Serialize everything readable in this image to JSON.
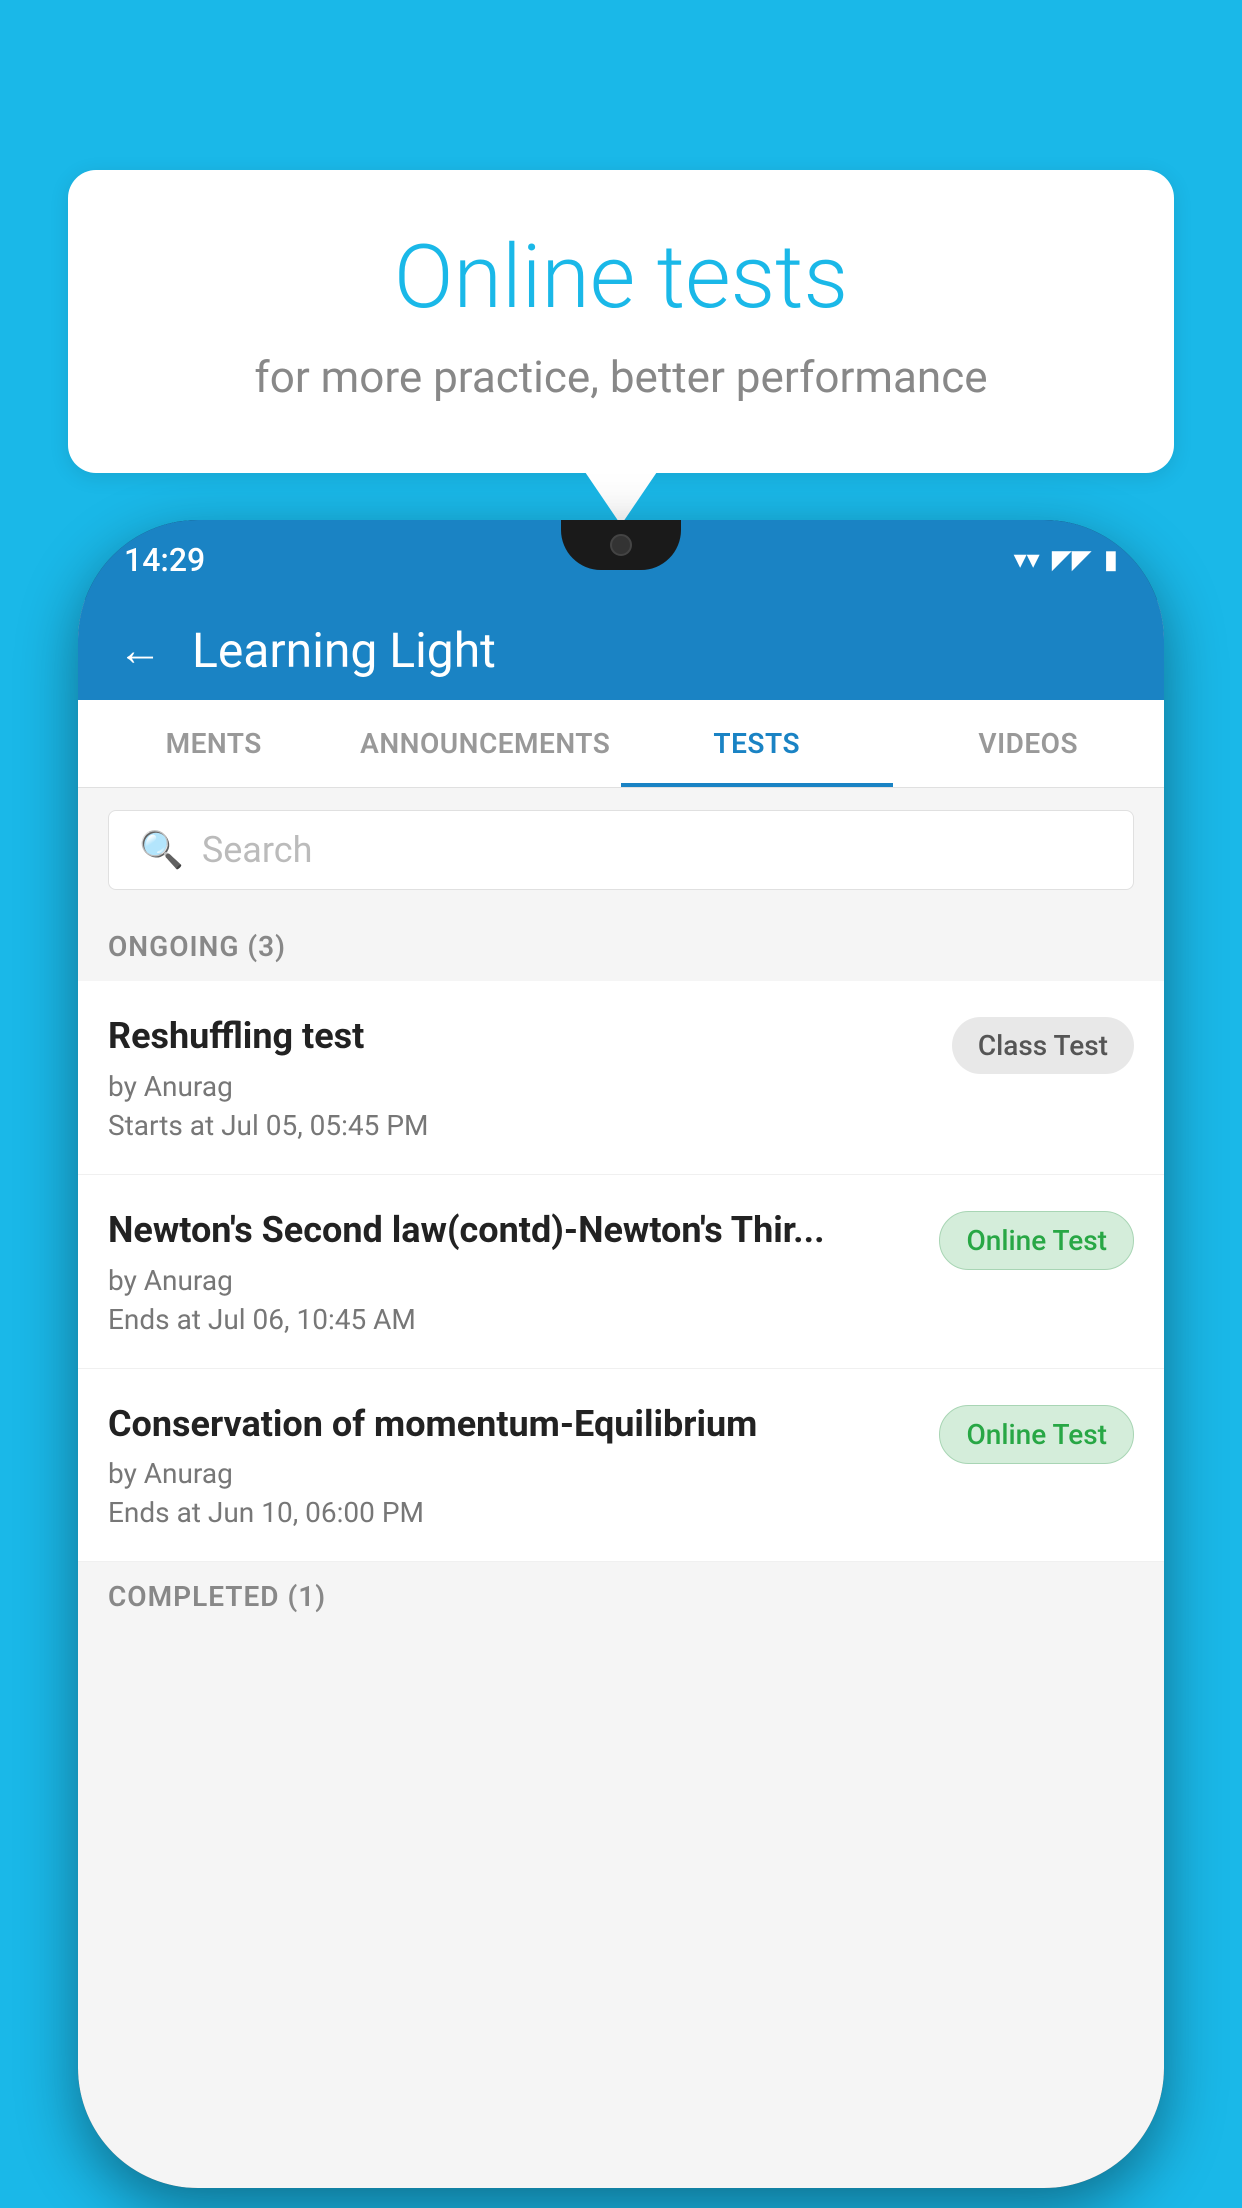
{
  "background_color": "#1ab8e8",
  "speech_bubble": {
    "title": "Online tests",
    "subtitle": "for more practice, better performance"
  },
  "phone": {
    "status_bar": {
      "time": "14:29",
      "wifi_icon": "▾",
      "signal_icon": "▲",
      "battery_icon": "▮"
    },
    "app_header": {
      "back_label": "←",
      "title": "Learning Light"
    },
    "tabs": [
      {
        "label": "MENTS",
        "active": false
      },
      {
        "label": "ANNOUNCEMENTS",
        "active": false
      },
      {
        "label": "TESTS",
        "active": true
      },
      {
        "label": "VIDEOS",
        "active": false
      }
    ],
    "search": {
      "placeholder": "Search",
      "icon": "🔍"
    },
    "ongoing_section": {
      "label": "ONGOING (3)",
      "tests": [
        {
          "name": "Reshuffling test",
          "author": "by Anurag",
          "date_label": "Starts at",
          "date": "Jul 05, 05:45 PM",
          "badge": "Class Test",
          "badge_type": "class"
        },
        {
          "name": "Newton's Second law(contd)-Newton's Thir...",
          "author": "by Anurag",
          "date_label": "Ends at",
          "date": "Jul 06, 10:45 AM",
          "badge": "Online Test",
          "badge_type": "online"
        },
        {
          "name": "Conservation of momentum-Equilibrium",
          "author": "by Anurag",
          "date_label": "Ends at",
          "date": "Jun 10, 06:00 PM",
          "badge": "Online Test",
          "badge_type": "online"
        }
      ]
    },
    "completed_section": {
      "label": "COMPLETED (1)"
    }
  }
}
